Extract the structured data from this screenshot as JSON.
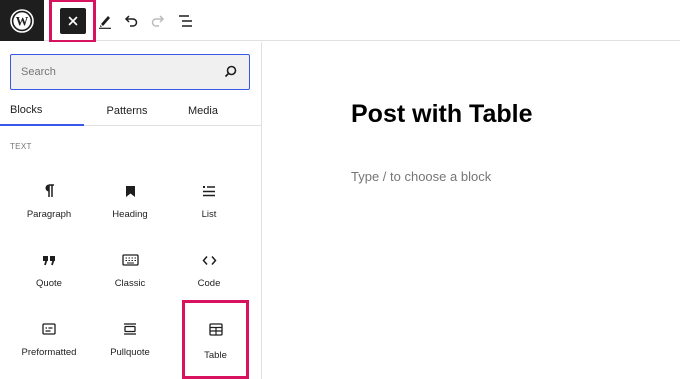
{
  "toolbar": {
    "logo_icon": "wordpress-logo-icon",
    "close_icon": "close-icon",
    "tools": [
      {
        "name": "pencil-icon"
      },
      {
        "name": "undo-icon"
      },
      {
        "name": "redo-icon"
      },
      {
        "name": "document-overview-icon"
      }
    ]
  },
  "inserter": {
    "search_placeholder": "Search",
    "tabs": [
      {
        "label": "Blocks",
        "active": true
      },
      {
        "label": "Patterns",
        "active": false
      },
      {
        "label": "Media",
        "active": false
      }
    ],
    "category_label": "TEXT",
    "blocks": [
      {
        "label": "Paragraph",
        "icon": "paragraph-icon"
      },
      {
        "label": "Heading",
        "icon": "heading-icon"
      },
      {
        "label": "List",
        "icon": "list-icon"
      },
      {
        "label": "Quote",
        "icon": "quote-icon"
      },
      {
        "label": "Classic",
        "icon": "keyboard-icon"
      },
      {
        "label": "Code",
        "icon": "code-icon"
      },
      {
        "label": "Preformatted",
        "icon": "preformatted-icon"
      },
      {
        "label": "Pullquote",
        "icon": "pullquote-icon"
      },
      {
        "label": "Table",
        "icon": "table-icon"
      }
    ]
  },
  "editor": {
    "post_title": "Post with Table",
    "block_placeholder": "Type / to choose a block"
  },
  "colors": {
    "accent": "#3858e9",
    "highlight": "#d8125f",
    "dark": "#1e1e1e"
  }
}
